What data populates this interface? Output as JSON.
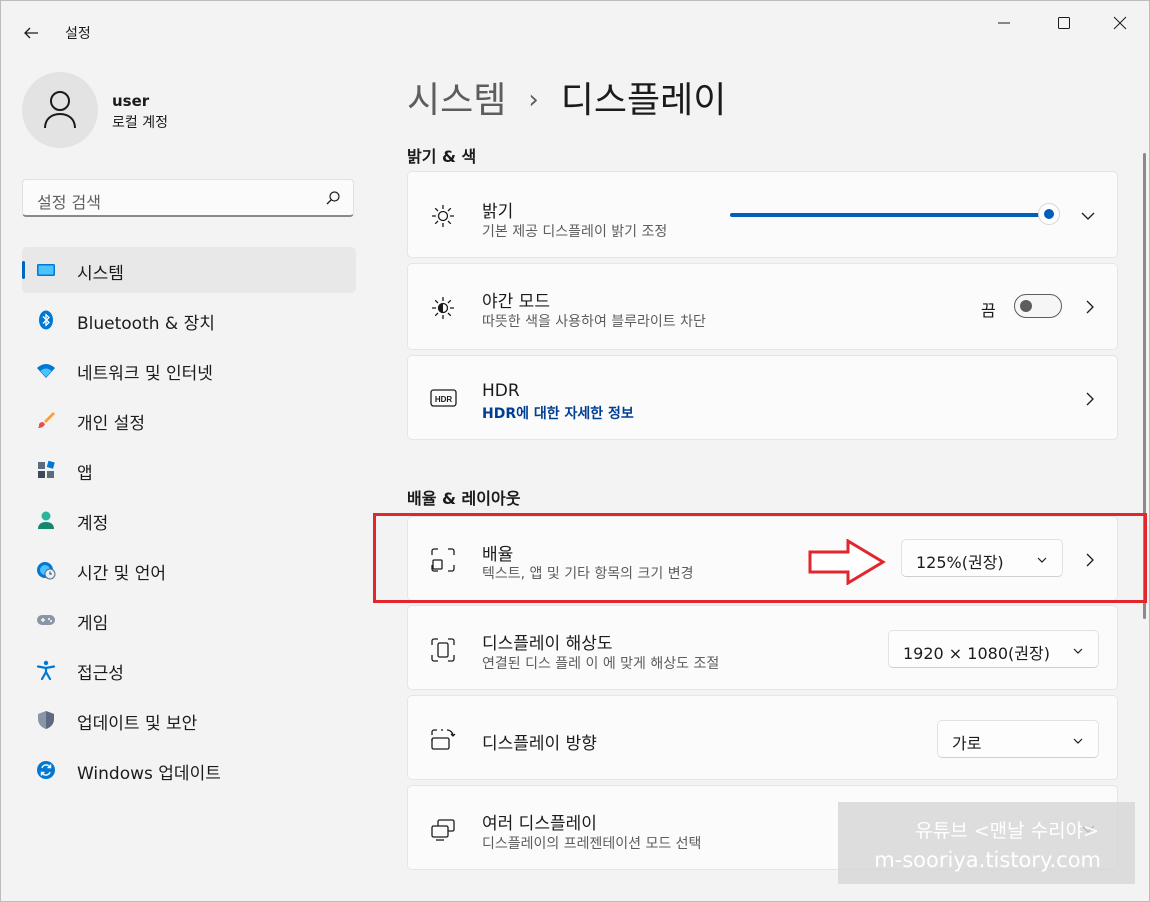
{
  "titlebar": {
    "title": "설정"
  },
  "user": {
    "name": "user",
    "account_type": "로컬 계정"
  },
  "search": {
    "placeholder": "설정 검색"
  },
  "sidebar": {
    "items": [
      {
        "label": "시스템",
        "icon": "system-icon",
        "active": true
      },
      {
        "label": "Bluetooth & 장치",
        "icon": "bluetooth-icon"
      },
      {
        "label": "네트워크 및 인터넷",
        "icon": "wifi-icon"
      },
      {
        "label": "개인 설정",
        "icon": "brush-icon"
      },
      {
        "label": "앱",
        "icon": "apps-icon"
      },
      {
        "label": "계정",
        "icon": "account-icon"
      },
      {
        "label": "시간 및 언어",
        "icon": "globe-clock-icon"
      },
      {
        "label": "게임",
        "icon": "gamepad-icon"
      },
      {
        "label": "접근성",
        "icon": "accessibility-icon"
      },
      {
        "label": "업데이트 및 보안",
        "icon": "shield-icon"
      },
      {
        "label": "Windows 업데이트",
        "icon": "update-icon"
      }
    ]
  },
  "breadcrumb": {
    "parent": "시스템",
    "separator": "›",
    "current": "디스플레이"
  },
  "sections": {
    "brightness_color": "밝기 & 색",
    "scale_layout": "배율 & 레이아웃"
  },
  "cards": {
    "brightness": {
      "title": "밝기",
      "subtitle": "기본 제공 디스플레이 밝기 조정",
      "level": 1.0
    },
    "night_mode": {
      "title": "야간 모드",
      "subtitle": "따뜻한 색을 사용하여 블루라이트 차단",
      "state_label": "끔",
      "on": false
    },
    "hdr": {
      "title": "HDR",
      "link": "HDR에 대한 자세한 정보"
    },
    "scale": {
      "title": "배율",
      "subtitle": "텍스트, 앱 및 기타 항목의 크기 변경",
      "value": "125%(권장)"
    },
    "resolution": {
      "title": "디스플레이 해상도",
      "subtitle": "연결된 디스 플레 이 에 맞게 해상도 조절",
      "value": "1920 × 1080(권장)"
    },
    "orientation": {
      "title": "디스플레이 방향",
      "value": "가로"
    },
    "multi_display": {
      "title": "여러 디스플레이",
      "subtitle": "디스플레이의 프레젠테이션 모드 선택"
    }
  },
  "watermark": {
    "line1": "유튜브 <맨날 수리야>",
    "line2": "m-sooriya.tistory.com"
  },
  "colors": {
    "accent": "#005fb8",
    "highlight": "#e3262c",
    "link": "#003e92"
  }
}
